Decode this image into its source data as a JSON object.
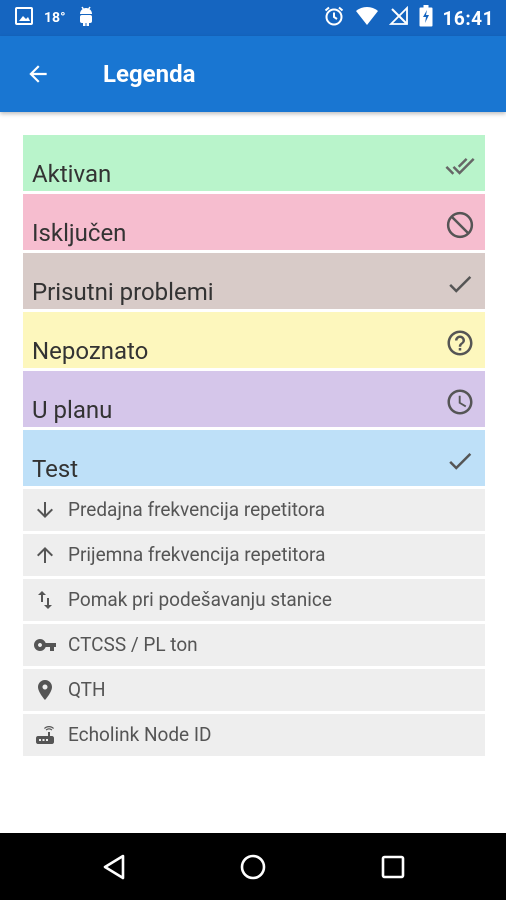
{
  "status_bar": {
    "temperature": "18°",
    "time": "16:41"
  },
  "app_bar": {
    "title": "Legenda"
  },
  "legend_statuses": [
    {
      "label": "Aktivan",
      "color": "#b9f4cb",
      "icon": "double-check-icon"
    },
    {
      "label": "Isključen",
      "color": "#f6bdcf",
      "icon": "block-icon"
    },
    {
      "label": "Prisutni problemi",
      "color": "#d8cbc8",
      "icon": "check-icon"
    },
    {
      "label": "Nepoznato",
      "color": "#fdf7bd",
      "icon": "help-circle-icon"
    },
    {
      "label": "U planu",
      "color": "#d5c6ea",
      "icon": "clock-icon"
    },
    {
      "label": "Test",
      "color": "#bee0f8",
      "icon": "check-icon"
    }
  ],
  "legend_fields": [
    {
      "label": "Predajna frekvencija repetitora",
      "icon": "arrow-down-icon"
    },
    {
      "label": "Prijemna frekvencija repetitora",
      "icon": "arrow-up-icon"
    },
    {
      "label": "Pomak pri podešavanju stanice",
      "icon": "swap-vertical-icon"
    },
    {
      "label": "CTCSS / PL ton",
      "icon": "key-icon"
    },
    {
      "label": "QTH",
      "icon": "location-pin-icon"
    },
    {
      "label": "Echolink Node ID",
      "icon": "router-icon"
    }
  ],
  "colors": {
    "status_bar": "#1565c0",
    "app_bar": "#1976d2",
    "field_row": "#eeeeee"
  }
}
